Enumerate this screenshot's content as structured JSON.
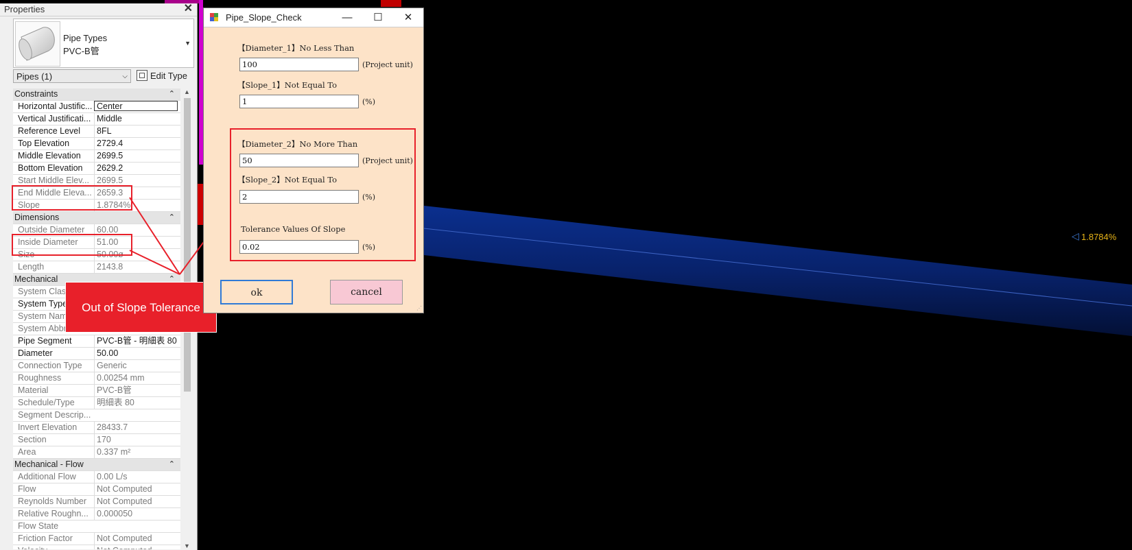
{
  "colors": {
    "highlight": "#e8202a",
    "dialog_bg": "#fde3c8",
    "cancel_bg": "#f8c8d4",
    "pipe_blue": "#0a2e8a",
    "slope_tag": "#e8b418"
  },
  "viewport": {
    "slope_tag": "1.8784%"
  },
  "properties": {
    "title": "Properties",
    "type_line1": "Pipe Types",
    "type_line2": "PVC-B管",
    "instance_selector": "Pipes (1)",
    "edit_type": "Edit Type",
    "groups": [
      {
        "name": "Constraints",
        "rows": [
          {
            "k": "Horizontal Justific...",
            "v": "Center",
            "ro": false,
            "sel": true
          },
          {
            "k": "Vertical Justificati...",
            "v": "Middle",
            "ro": false
          },
          {
            "k": "Reference Level",
            "v": "8FL",
            "ro": false
          },
          {
            "k": "Top Elevation",
            "v": "2729.4",
            "ro": false
          },
          {
            "k": "Middle Elevation",
            "v": "2699.5",
            "ro": false
          },
          {
            "k": "Bottom Elevation",
            "v": "2629.2",
            "ro": false
          },
          {
            "k": "Start Middle Elev...",
            "v": "2699.5",
            "ro": true
          },
          {
            "k": "End Middle Eleva...",
            "v": "2659.3",
            "ro": true
          },
          {
            "k": "Slope",
            "v": "1.8784%",
            "ro": true
          }
        ]
      },
      {
        "name": "Dimensions",
        "rows": [
          {
            "k": "Outside Diameter",
            "v": "60.00",
            "ro": true
          },
          {
            "k": "Inside Diameter",
            "v": "51.00",
            "ro": true
          },
          {
            "k": "Size",
            "v": "50.00ø",
            "ro": true
          },
          {
            "k": "Length",
            "v": "2143.8",
            "ro": true
          }
        ]
      },
      {
        "name": "Mechanical",
        "rows": [
          {
            "k": "System Classi...",
            "v": "",
            "ro": true
          },
          {
            "k": "System Type",
            "v": "",
            "ro": false
          },
          {
            "k": "System Name",
            "v": "",
            "ro": true
          },
          {
            "k": "System Abbr...",
            "v": "",
            "ro": true
          },
          {
            "k": "Pipe Segment",
            "v": "PVC-B管 - 明細表 80",
            "ro": false
          },
          {
            "k": "Diameter",
            "v": "50.00",
            "ro": false
          },
          {
            "k": "Connection Type",
            "v": "Generic",
            "ro": true
          },
          {
            "k": "Roughness",
            "v": "0.00254 mm",
            "ro": true
          },
          {
            "k": "Material",
            "v": "PVC-B管",
            "ro": true
          },
          {
            "k": "Schedule/Type",
            "v": "明細表 80",
            "ro": true
          },
          {
            "k": "Segment Descrip...",
            "v": "",
            "ro": true
          },
          {
            "k": "Invert Elevation",
            "v": "28433.7",
            "ro": true
          },
          {
            "k": "Section",
            "v": "170",
            "ro": true
          },
          {
            "k": "Area",
            "v": "0.337 m²",
            "ro": true
          }
        ]
      },
      {
        "name": "Mechanical - Flow",
        "rows": [
          {
            "k": "Additional Flow",
            "v": "0.00 L/s",
            "ro": true
          },
          {
            "k": "Flow",
            "v": "Not Computed",
            "ro": true
          },
          {
            "k": "Reynolds Number",
            "v": "Not Computed",
            "ro": true
          },
          {
            "k": "Relative Roughn...",
            "v": "0.000050",
            "ro": true
          },
          {
            "k": "Flow State",
            "v": "",
            "ro": true
          },
          {
            "k": "Friction Factor",
            "v": "Not Computed",
            "ro": true
          },
          {
            "k": "Velocity",
            "v": "Not Computed",
            "ro": true
          }
        ]
      }
    ]
  },
  "annotation": {
    "callout": "Out of Slope Tolerance"
  },
  "dialog": {
    "title": "Pipe_Slope_Check",
    "min_glyph": "—",
    "max_glyph": "☐",
    "close_glyph": "✕",
    "diameter1_label": "【Diameter_1】No Less Than",
    "diameter1_value": "100",
    "diameter1_unit": "(Project unit)",
    "slope1_label": "【Slope_1】Not Equal To",
    "slope1_value": "1",
    "slope1_unit": "(%)",
    "diameter2_label": "【Diameter_2】No More Than",
    "diameter2_value": "50",
    "diameter2_unit": "(Project unit)",
    "slope2_label": "【Slope_2】Not Equal To",
    "slope2_value": "2",
    "slope2_unit": "(%)",
    "tolerance_label": "Tolerance Values Of Slope",
    "tolerance_value": "0.02",
    "tolerance_unit": "(%)",
    "ok_label": "ok",
    "cancel_label": "cancel"
  }
}
